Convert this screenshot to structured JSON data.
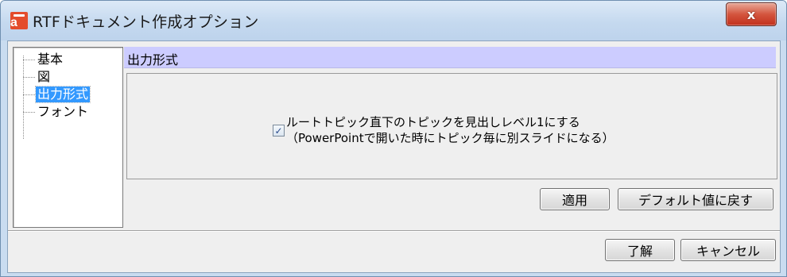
{
  "window": {
    "title": "RTFドキュメント作成オプション",
    "close_label": "x",
    "icon": "app-icon"
  },
  "tree": {
    "items": [
      {
        "label": "基本",
        "selected": false
      },
      {
        "label": "図",
        "selected": false
      },
      {
        "label": "出力形式",
        "selected": true
      },
      {
        "label": "フォント",
        "selected": false
      }
    ]
  },
  "panel": {
    "header": "出力形式",
    "option": {
      "checked": true,
      "line1": "ルートトピック直下のトピックを見出しレベル1にする",
      "line2": "（PowerPointで開いた時にトピック毎に別スライドになる）"
    }
  },
  "buttons": {
    "apply": "適用",
    "reset_default": "デフォルト値に戻す",
    "ok": "了解",
    "cancel": "キャンセル"
  },
  "colors": {
    "selection": "#3399ff",
    "panel_header_bg": "#ccccff",
    "close_button": "#c2301c"
  }
}
